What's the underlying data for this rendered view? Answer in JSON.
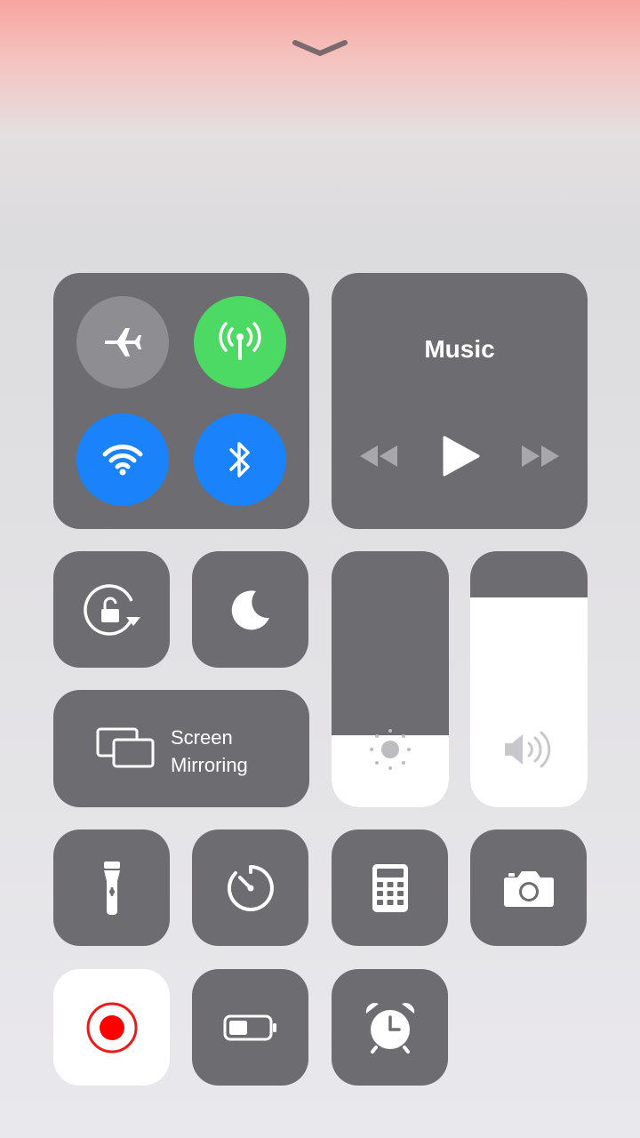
{
  "header": {
    "handle_icon": "chevron-down-icon"
  },
  "connectivity": {
    "airplane": {
      "icon": "airplane-icon",
      "state": "off",
      "color": "#8e8d92"
    },
    "cellular": {
      "icon": "antenna-icon",
      "state": "on",
      "color": "#4cd964"
    },
    "wifi": {
      "icon": "wifi-icon",
      "state": "on",
      "color": "#1a82fb"
    },
    "bluetooth": {
      "icon": "bluetooth-icon",
      "state": "on",
      "color": "#1a82fb"
    }
  },
  "music": {
    "title": "Music",
    "controls": [
      "rewind-icon",
      "play-icon",
      "fast-forward-icon"
    ]
  },
  "toggles": {
    "rotation_lock": {
      "icon": "rotation-lock-icon"
    },
    "do_not_disturb": {
      "icon": "moon-icon"
    }
  },
  "screen_mirroring": {
    "line1": "Screen",
    "line2": "Mirroring",
    "icon": "screen-mirroring-icon"
  },
  "brightness": {
    "icon": "sun-icon",
    "level": 0.28
  },
  "volume": {
    "icon": "speaker-icon",
    "level": 0.82
  },
  "shortcuts": [
    {
      "id": "flashlight",
      "icon": "flashlight-icon"
    },
    {
      "id": "timer",
      "icon": "timer-icon"
    },
    {
      "id": "calculator",
      "icon": "calculator-icon"
    },
    {
      "id": "camera",
      "icon": "camera-icon"
    },
    {
      "id": "screen_recording",
      "icon": "record-icon",
      "accent": "#ff0000"
    },
    {
      "id": "low_power",
      "icon": "battery-icon"
    },
    {
      "id": "alarm",
      "icon": "alarm-clock-icon"
    }
  ]
}
